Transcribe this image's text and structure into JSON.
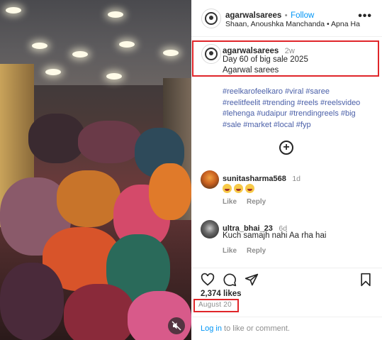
{
  "post": {
    "username": "agarwalsarees",
    "follow_label": "Follow",
    "dot": "•",
    "audio_line": "Shaan, Anoushka Manchanda • Apna Ha...",
    "more_label": "•••"
  },
  "caption": {
    "username": "agarwalsarees",
    "time": "2w",
    "line1": "Day 60 of big sale 2025",
    "line2": "Agarwal sarees"
  },
  "hashtags": [
    "#reelkarofeelkaro",
    "#viral",
    "#saree",
    "#reelitfeelit",
    "#trending",
    "#reels",
    "#reelsvideo",
    "#lehenga",
    "#udaipur",
    "#trendingreels",
    "#big",
    "#sale",
    "#market",
    "#local",
    "#fyp"
  ],
  "load_more_icon": "plus-circle-icon",
  "comments": [
    {
      "username": "sunitasharma568",
      "time": "1d",
      "text": "",
      "emoji_count": 3,
      "like_label": "Like",
      "reply_label": "Reply"
    },
    {
      "username": "ultra_bhai_23",
      "time": "6d",
      "text": "Kuch samajh nahi Aa rha hai",
      "like_label": "Like",
      "reply_label": "Reply"
    }
  ],
  "engagement": {
    "likes": "2,374 likes",
    "date": "August 20"
  },
  "login": {
    "link": "Log in",
    "rest": " to like or comment."
  },
  "colors": {
    "accent_blue": "#0095f6",
    "hashtag_blue": "#4a5fa8",
    "highlight_red": "#e0262a"
  }
}
